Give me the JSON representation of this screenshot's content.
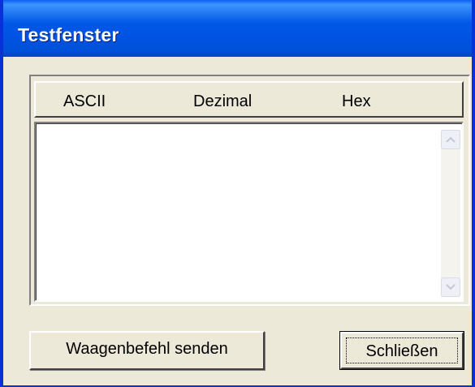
{
  "window": {
    "title": "Testfenster"
  },
  "table": {
    "columns": [
      "ASCII",
      "Dezimal",
      "Hex"
    ],
    "rows": []
  },
  "buttons": {
    "send_label": "Waagenbefehl senden",
    "close_label": "Schließen"
  },
  "icons": {
    "scroll_up": "chevron-up-icon",
    "scroll_down": "chevron-down-icon"
  },
  "colors": {
    "titlebar": "#0054e3",
    "window_face": "#ece9d8",
    "list_background": "#ffffff"
  }
}
